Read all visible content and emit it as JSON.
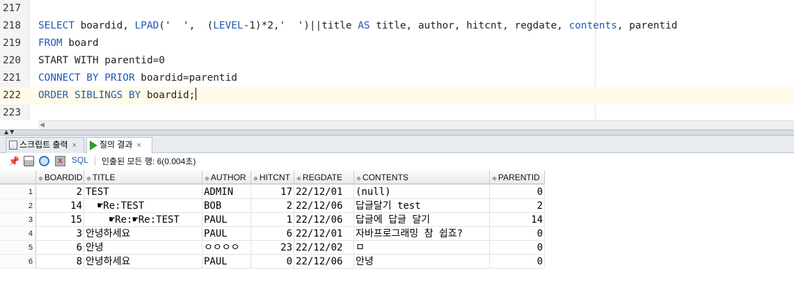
{
  "editor": {
    "lines": [
      {
        "num": "217",
        "segments": []
      },
      {
        "num": "218",
        "segments": [
          {
            "t": "SELECT",
            "kw": true
          },
          {
            "t": " boardid, "
          },
          {
            "t": "LPAD",
            "kw": true
          },
          {
            "t": "('  ',  ("
          },
          {
            "t": "LEVEL",
            "kw": true
          },
          {
            "t": "-1)*2,'  ')||title "
          },
          {
            "t": "AS",
            "kw": true
          },
          {
            "t": " title, author, hitcnt, regdate, "
          },
          {
            "t": "contents",
            "kw": true
          },
          {
            "t": ", parentid"
          }
        ]
      },
      {
        "num": "219",
        "segments": [
          {
            "t": "FROM",
            "kw": true
          },
          {
            "t": " board"
          }
        ]
      },
      {
        "num": "220",
        "segments": [
          {
            "t": "START WITH parentid=0"
          }
        ]
      },
      {
        "num": "221",
        "segments": [
          {
            "t": "CONNECT BY PRIOR",
            "kw": true
          },
          {
            "t": " boardid=parentid"
          }
        ]
      },
      {
        "num": "222",
        "current": true,
        "caret": true,
        "segments": [
          {
            "t": "ORDER SIBLINGS BY",
            "kw": true
          },
          {
            "t": " boardid;"
          }
        ]
      },
      {
        "num": "223",
        "segments": []
      }
    ]
  },
  "tabs": [
    {
      "label": "스크립트 출력",
      "icon": "script-output-icon",
      "active": false
    },
    {
      "label": "질의 결과",
      "icon": "run-query-icon",
      "active": true
    }
  ],
  "toolbar": {
    "sql_label": "SQL",
    "status": "인출된 모든 행: 6(0.004초)"
  },
  "grid": {
    "columns": [
      "BOARDID",
      "TITLE",
      "AUTHOR",
      "HITCNT",
      "REGDATE",
      "CONTENTS",
      "PARENTID"
    ],
    "rows": [
      {
        "rownum": "1",
        "cells": [
          "2",
          "TEST",
          "ADMIN",
          "17",
          "22/12/01",
          "(null)",
          "0"
        ]
      },
      {
        "rownum": "2",
        "cells": [
          "14",
          "  ☛Re:TEST",
          "BOB",
          "2",
          "22/12/06",
          "답글달기 test",
          "2"
        ]
      },
      {
        "rownum": "3",
        "cells": [
          "15",
          "    ☛Re:☛Re:TEST",
          "PAUL",
          "1",
          "22/12/06",
          "답글에 답글 달기",
          "14"
        ]
      },
      {
        "rownum": "4",
        "cells": [
          "3",
          "안녕하세요",
          "PAUL",
          "6",
          "22/12/01",
          "자바프로그래밍 참 쉽죠?",
          "0"
        ]
      },
      {
        "rownum": "5",
        "cells": [
          "6",
          "안녕",
          "ㅇㅇㅇㅇ",
          "23",
          "22/12/02",
          "ㅁ",
          "0"
        ]
      },
      {
        "rownum": "6",
        "cells": [
          "8",
          "안녕하세요",
          "PAUL",
          "0",
          "22/12/06",
          "안녕",
          "0"
        ]
      }
    ]
  }
}
